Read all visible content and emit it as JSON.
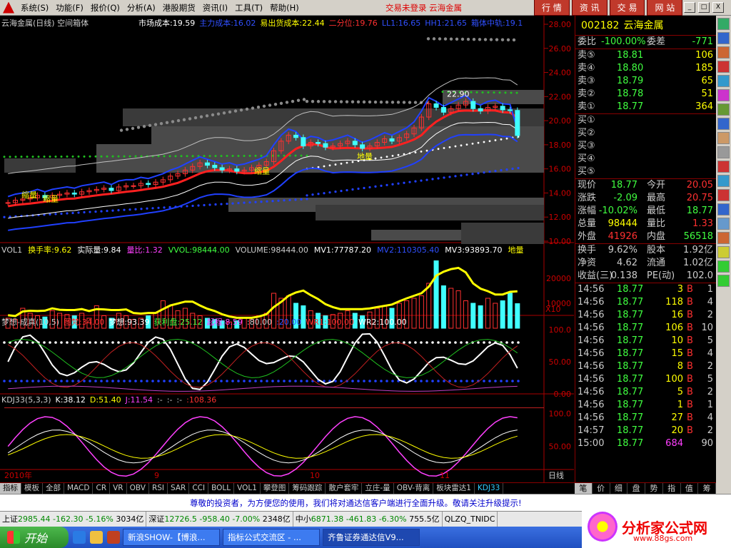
{
  "menu": {
    "items": [
      "系统(S)",
      "功能(F)",
      "报价(Q)",
      "分析(A)",
      "港股期货",
      "资讯(I)",
      "工具(T)",
      "帮助(H)"
    ],
    "status": "交易未登录  云海金属",
    "top_buttons": [
      "行 情",
      "资 讯",
      "交 易",
      "网 站"
    ],
    "window_buttons": [
      "_",
      "□",
      "X"
    ]
  },
  "main_panel": {
    "title": "云海金属(日线) 空间箱体",
    "indicators": [
      {
        "text": "市场成本:19.59",
        "color": "#ffffff"
      },
      {
        "text": "主力成本:16.02",
        "color": "#3050ff"
      },
      {
        "text": "易出货成本:22.44",
        "color": "#ffff00"
      },
      {
        "text": "二分位:19.76",
        "color": "#ff3030"
      },
      {
        "text": "LL1:16.65",
        "color": "#3050ff"
      },
      {
        "text": "HH1:21.65",
        "color": "#3050ff"
      },
      {
        "text": "箱体中轨:19.1",
        "color": "#3050ff"
      }
    ],
    "y_ticks": [
      "28.00",
      "26.00",
      "24.00",
      "22.00",
      "20.00",
      "18.00",
      "16.00",
      "14.00",
      "12.00",
      "10.00"
    ],
    "annotations": [
      "22.90",
      "缩量",
      "缩量",
      "缩量",
      "缩量",
      "地量",
      "地量"
    ]
  },
  "vol_panel": {
    "labels": [
      {
        "text": "VOL1",
        "color": "#cccccc"
      },
      {
        "text": "换手率:9.62",
        "color": "#ffff00"
      },
      {
        "text": "实际量:9.84",
        "color": "#ffffff"
      },
      {
        "text": "量比:1.32",
        "color": "#ff40ff"
      },
      {
        "text": "VVOL:98444.00",
        "color": "#40ff40"
      },
      {
        "text": "VOLUME:98444.00",
        "color": "#cccccc"
      },
      {
        "text": "MV1:77787.20",
        "color": "#ffffff"
      },
      {
        "text": "MV2:110305.40",
        "color": "#3050ff"
      },
      {
        "text": "MV3:93893.70",
        "color": "#ffffff"
      },
      {
        "text": "地量",
        "color": "#ffff00"
      }
    ],
    "y_ticks": [
      "20000",
      "10000"
    ],
    "unit": "X10"
  },
  "dream_panel": {
    "labels": [
      {
        "text": "梦想-成真(10,5)",
        "color": "#cccccc"
      },
      {
        "text": "图梵:34.00",
        "color": "#ff3030"
      },
      {
        "text": "梦想:93.39",
        "color": "#ffffff"
      },
      {
        "text": "获利盘:25.12",
        "color": "#40ff40"
      },
      {
        "text": "起程:8.59",
        "color": "#ff40ff"
      },
      {
        "text": ":80.00",
        "color": "#cccccc"
      },
      {
        "text": ":20.00",
        "color": "#3050ff"
      },
      {
        "text": "WR1:100.00",
        "color": "#ff3030"
      },
      {
        "text": "WR2:100.00",
        "color": "#ffffff"
      }
    ],
    "y_ticks": [
      "100.0",
      "50.00",
      "0.00"
    ]
  },
  "kdj_panel": {
    "labels": [
      {
        "text": "KDJ33(5,3,3)",
        "color": "#cccccc"
      },
      {
        "text": "K:38.12",
        "color": "#ffffff"
      },
      {
        "text": "D:51.40",
        "color": "#ffff00"
      },
      {
        "text": "J:11.54",
        "color": "#ff40ff"
      },
      {
        "text": ":-",
        "color": "#cccccc"
      },
      {
        "text": ":-",
        "color": "#cccccc"
      },
      {
        "text": ":-",
        "color": "#cccccc"
      },
      {
        "text": ":108.36",
        "color": "#ff3030"
      }
    ],
    "y_ticks": [
      "100.0",
      "50.00"
    ]
  },
  "date_axis": {
    "labels": [
      "2010年",
      "9",
      "10",
      "11"
    ],
    "period": "日线"
  },
  "bottom_tabs": [
    "指标",
    "模板",
    "全部",
    "MACD",
    "CR",
    "VR",
    "OBV",
    "RSI",
    "SAR",
    "CCI",
    "BOLL",
    "VOL1",
    "攀登图",
    "筹码跟踪",
    "散户套牢",
    "立庄-量",
    "OBV-背离",
    "板块雷达1",
    "KDJ33"
  ],
  "quote": {
    "code": "002182",
    "name": "云海金属",
    "weibi_label": "委比",
    "weibi": "-100.00%",
    "weicha_label": "委差",
    "weicha": "-771",
    "asks": [
      {
        "label": "卖⑤",
        "price": "18.81",
        "vol": "106"
      },
      {
        "label": "卖④",
        "price": "18.80",
        "vol": "185"
      },
      {
        "label": "卖③",
        "price": "18.79",
        "vol": "65"
      },
      {
        "label": "卖②",
        "price": "18.78",
        "vol": "51"
      },
      {
        "label": "卖①",
        "price": "18.77",
        "vol": "364"
      }
    ],
    "bids": [
      "买①",
      "买②",
      "买③",
      "买④",
      "买⑤"
    ],
    "stats": [
      {
        "l1": "现价",
        "v1": "18.77",
        "c1": "#40ff40",
        "l2": "今开",
        "v2": "20.05",
        "c2": "#ff3030"
      },
      {
        "l1": "涨跌",
        "v1": "-2.09",
        "c1": "#40ff40",
        "l2": "最高",
        "v2": "20.75",
        "c2": "#ff3030"
      },
      {
        "l1": "涨幅",
        "v1": "-10.02%",
        "c1": "#40ff40",
        "l2": "最低",
        "v2": "18.77",
        "c2": "#40ff40"
      },
      {
        "l1": "总量",
        "v1": "98444",
        "c1": "#ffff00",
        "l2": "量比",
        "v2": "1.33",
        "c2": "#ff3030"
      },
      {
        "l1": "外盘",
        "v1": "41926",
        "c1": "#ff3030",
        "l2": "内盘",
        "v2": "56518",
        "c2": "#40ff40"
      }
    ],
    "fundamentals": [
      {
        "l1": "换手",
        "v1": "9.62%",
        "l2": "股本",
        "v2": "1.92亿"
      },
      {
        "l1": "净资",
        "v1": "4.62",
        "l2": "流通",
        "v2": "1.02亿"
      },
      {
        "l1": "收益(三)",
        "v1": "0.138",
        "l2": "PE(动)",
        "v2": "102.0"
      }
    ],
    "ticks": [
      {
        "time": "14:56",
        "price": "18.77",
        "vol": "3",
        "bs": "B",
        "n": "1"
      },
      {
        "time": "14:56",
        "price": "18.77",
        "vol": "118",
        "bs": "B",
        "n": "4"
      },
      {
        "time": "14:56",
        "price": "18.77",
        "vol": "16",
        "bs": "B",
        "n": "2"
      },
      {
        "time": "14:56",
        "price": "18.77",
        "vol": "106",
        "bs": "B",
        "n": "10"
      },
      {
        "time": "14:56",
        "price": "18.77",
        "vol": "10",
        "bs": "B",
        "n": "5"
      },
      {
        "time": "14:56",
        "price": "18.77",
        "vol": "15",
        "bs": "B",
        "n": "4"
      },
      {
        "time": "14:56",
        "price": "18.77",
        "vol": "8",
        "bs": "B",
        "n": "2"
      },
      {
        "time": "14:56",
        "price": "18.77",
        "vol": "100",
        "bs": "B",
        "n": "5"
      },
      {
        "time": "14:56",
        "price": "18.77",
        "vol": "5",
        "bs": "B",
        "n": "2"
      },
      {
        "time": "14:56",
        "price": "18.77",
        "vol": "1",
        "bs": "B",
        "n": "1"
      },
      {
        "time": "14:56",
        "price": "18.77",
        "vol": "27",
        "bs": "B",
        "n": "4"
      },
      {
        "time": "14:57",
        "price": "18.77",
        "vol": "20",
        "bs": "B",
        "n": "2"
      },
      {
        "time": "15:00",
        "price": "18.77",
        "vol": "684",
        "bs": "",
        "n": "90"
      }
    ],
    "tabs": [
      "笔",
      "价",
      "细",
      "盘",
      "势",
      "指",
      "值",
      "筹"
    ]
  },
  "notice": "尊敬的投资者，为方便您的使用，我们将对通达信客户端进行全面升级。敬请关注升级提示!",
  "index_bar": [
    {
      "name": "上证",
      "val": "2985.44",
      "chg": "-162.30",
      "pct": "-5.16%",
      "amt": "3034亿"
    },
    {
      "name": "深证",
      "val": "12726.5",
      "chg": "-958.40",
      "pct": "-7.00%",
      "amt": "2348亿"
    },
    {
      "name": "中小",
      "val": "6871.38",
      "chg": "-461.83",
      "pct": "-6.30%",
      "amt": "755.5亿"
    }
  ],
  "index_extra": "QLZQ_TNIDC",
  "taskbar": {
    "start": "开始",
    "tasks": [
      "新浪SHOW-【博浪...",
      "指标公式交流区 - ...",
      "齐鲁证券通达信V9..."
    ]
  },
  "brand": {
    "title": "分析家公式网",
    "url": "www.88gs.com"
  },
  "chart_data": {
    "type": "candlestick",
    "ylim": [
      10,
      28
    ],
    "closes": [
      13.2,
      13.4,
      13.5,
      13.6,
      13.8,
      13.6,
      13.8,
      13.9,
      14.0,
      13.9,
      14.1,
      14.2,
      14.3,
      14.4,
      14.2,
      14.5,
      14.6,
      14.6,
      14.8,
      14.7,
      14.9,
      15.1,
      15.4,
      15.6,
      15.9,
      16.2,
      16.5,
      16.3,
      16.1,
      15.9,
      16.0,
      15.8,
      15.9,
      16.1,
      16.3,
      16.6,
      17.5,
      18.3,
      18.8,
      18.6,
      17.9,
      18.2,
      18.1,
      17.8,
      17.9,
      18.1,
      18.3,
      18.0,
      17.7,
      17.9,
      18.2,
      18.5,
      18.3,
      18.6,
      18.9,
      19.4,
      20.3,
      21.4,
      21.1,
      20.7,
      21.0,
      21.3,
      21.6,
      21.0,
      20.8,
      21.1,
      21.2,
      20.9,
      20.85,
      18.77
    ],
    "volumes": [
      4000,
      3500,
      8000,
      6000,
      5000,
      4500,
      7000,
      6000,
      5500,
      5000,
      6000,
      4000,
      9000,
      5000,
      4000,
      6000,
      5000,
      3500,
      4000,
      5000,
      6000,
      11000,
      9000,
      7000,
      8000,
      6000,
      5000,
      4000,
      3500,
      3000,
      2500,
      3000,
      4000,
      3500,
      5000,
      6000,
      14000,
      12000,
      13000,
      10000,
      9000,
      7000,
      6000,
      5000,
      5500,
      6000,
      7000,
      6000,
      5000,
      6500,
      8000,
      9000,
      8000,
      10000,
      11000,
      12000,
      13000,
      18000,
      27000,
      17000,
      16000,
      15000,
      11000,
      10000,
      9000,
      12000,
      10000,
      11000,
      14000,
      9844
    ],
    "volume_unit": "X10",
    "dream_ylim": [
      0,
      100
    ],
    "kdj_ylim": [
      0,
      110
    ]
  }
}
